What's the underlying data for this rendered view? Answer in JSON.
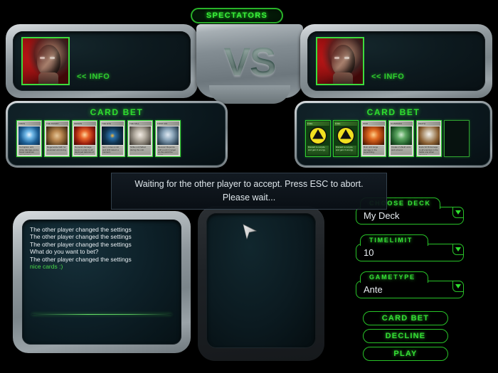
{
  "header": {
    "spectators_label": "SPECTATORS",
    "vs_label": "VS"
  },
  "players": {
    "left": {
      "info_label": "<< INFO",
      "avatar_icon": "player-portrait-icon"
    },
    "right": {
      "info_label": "<< INFO",
      "avatar_icon": "player-portrait-icon"
    }
  },
  "bets": {
    "left": {
      "title": "CARD BET",
      "cards": [
        {
          "name": "VIRUS",
          "desc": "Corruption unit, strike damage and a boost maximum deterioration.",
          "art": "blue"
        },
        {
          "name": "THE INJURY",
          "desc": "Regenerate faith for wounded unit during.",
          "art": "tan"
        },
        {
          "name": "DEMON",
          "desc": "Demonic damage boost in order to all deployed defence of a unit one.",
          "art": "red"
        },
        {
          "name": "THE EYE",
          "desc": "Item, move a unit and shift detect a moment.",
          "art": "eye"
        },
        {
          "name": "THE FALL",
          "desc": "Strike unit fallout during the unit.",
          "art": "pale"
        },
        {
          "name": "FIRST AID",
          "desc": "Recover lifepoints with a unit in target on the ward the cards.",
          "art": "medic"
        }
      ]
    },
    "right": {
      "title": "CARD BET",
      "cards": [
        {
          "name": "FUEL",
          "desc": "Discard to recycle and gain 3 energy.",
          "art": "radiation"
        },
        {
          "name": "FUEL",
          "desc": "Discard to recycle and gain 3 energy.",
          "art": "radiation"
        },
        {
          "name": "WAR",
          "desc": "Ruin unit range damage in the superstring.",
          "art": "orange"
        },
        {
          "name": "GUARDIAN",
          "desc": "Create 2 shield units and a boost.",
          "art": "greenbot"
        },
        {
          "name": "DEATH",
          "desc": "Ends 3d fill damage to all enemies in the battle one when charged.",
          "art": "skull"
        },
        {
          "name": "",
          "desc": "",
          "art": "empty"
        }
      ]
    }
  },
  "modal": {
    "line1": "Waiting for the other player to accept. Press ESC to abort.",
    "line2": "Please wait..."
  },
  "chat": {
    "messages": [
      {
        "text": "The other player changed the settings",
        "own": false
      },
      {
        "text": "The other player changed the settings",
        "own": false
      },
      {
        "text": "The other player changed the settings",
        "own": false
      },
      {
        "text": "What do you want to bet?",
        "own": false
      },
      {
        "text": "The other player changed the settings",
        "own": false
      },
      {
        "text": "nice cards :)",
        "own": true
      }
    ]
  },
  "controls": {
    "deck": {
      "label": "CHOOSE DECK",
      "value": "My Deck",
      "caret_icon": "chevron-down-icon"
    },
    "timelimit": {
      "label": "TIMELIMIT",
      "value": "10",
      "caret_icon": "chevron-down-icon"
    },
    "gametype": {
      "label": "GAMETYPE",
      "value": "Ante",
      "caret_icon": "chevron-down-icon"
    }
  },
  "buttons": {
    "card_bet": "CARD BET",
    "decline": "DECLINE",
    "play": "PLAY"
  },
  "colors": {
    "accent_green": "#2fdd2f",
    "panel_metal": "#8e979c",
    "screen_dark": "#0c1a20",
    "text_light": "#e8eef2"
  },
  "cursor": {
    "icon": "mouse-pointer-icon"
  }
}
